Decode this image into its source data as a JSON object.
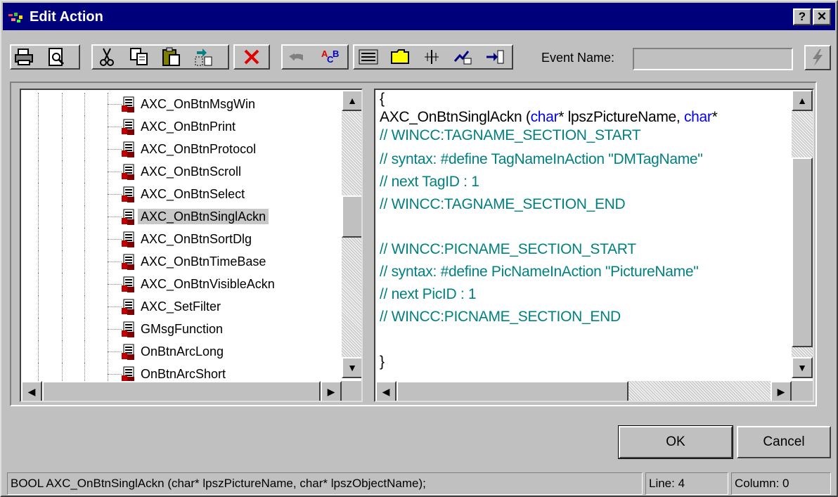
{
  "window": {
    "title": "Edit Action"
  },
  "titlebar_buttons": {
    "help": "?",
    "close": "✕"
  },
  "toolbar": {
    "icons": [
      "printer-icon",
      "print-preview-icon",
      "cut-icon",
      "copy-icon",
      "paste-icon",
      "replace-icon",
      "delete-icon",
      "undo-icon",
      "spell-check-icon",
      "insert-icon",
      "folder-icon",
      "tag-icon",
      "export-icon",
      "import-icon"
    ],
    "event_name_label": "Event Name:",
    "event_name_value": ""
  },
  "tree": {
    "items": [
      "AXC_OnBtnMsgWin",
      "AXC_OnBtnPrint",
      "AXC_OnBtnProtocol",
      "AXC_OnBtnScroll",
      "AXC_OnBtnSelect",
      "AXC_OnBtnSinglAckn",
      "AXC_OnBtnSortDlg",
      "AXC_OnBtnTimeBase",
      "AXC_OnBtnVisibleAckn",
      "AXC_SetFilter",
      "GMsgFunction",
      "OnBtnArcLong",
      "OnBtnArcShort"
    ],
    "selected_index": 5
  },
  "code": {
    "line0": "{",
    "line1_prefix": "AXC_OnBtnSinglAckn (",
    "line1_kw1": "char",
    "line1_mid": "* lpszPictureName, ",
    "line1_kw2": "char",
    "line1_end": "*",
    "line2": "// WINCC:TAGNAME_SECTION_START",
    "line3": "// syntax: #define TagNameInAction \"DMTagName\"",
    "line4": "// next TagID : 1",
    "line5": "// WINCC:TAGNAME_SECTION_END",
    "line7": "// WINCC:PICNAME_SECTION_START",
    "line8": "// syntax: #define PicNameInAction \"PictureName\"",
    "line9": "// next PicID : 1",
    "line10": "// WINCC:PICNAME_SECTION_END",
    "line12": "}"
  },
  "buttons": {
    "ok": "OK",
    "cancel": "Cancel"
  },
  "status": {
    "signature": "BOOL AXC_OnBtnSinglAckn (char* lpszPictureName, char* lpszObjectName);",
    "line": "Line: 4",
    "column": "Column: 0"
  },
  "colors": {
    "title_bg": "#00007b",
    "comment": "#008080",
    "keyword": "#0000ff",
    "selection": "#c8c8c8"
  }
}
